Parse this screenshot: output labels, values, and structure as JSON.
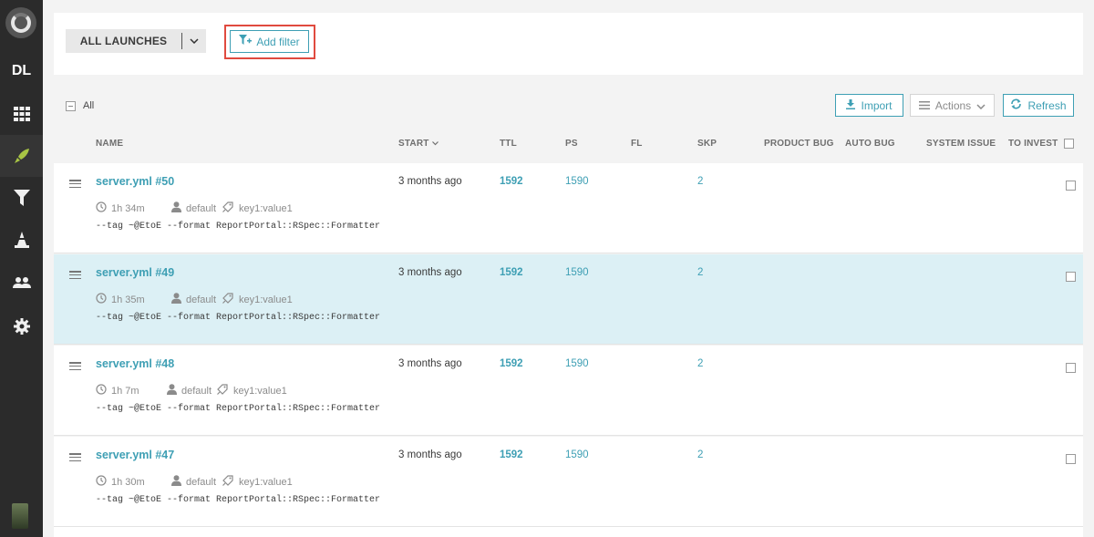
{
  "sidebar": {
    "logo": "reportportal-logo",
    "project_initials": "DL",
    "items": [
      {
        "icon": "dashboard-grid-icon"
      },
      {
        "icon": "launches-rocket-icon",
        "active": true
      },
      {
        "icon": "filter-icon"
      },
      {
        "icon": "debug-cone-icon"
      },
      {
        "icon": "members-icon"
      },
      {
        "icon": "settings-gear-icon"
      }
    ],
    "avatar": "user-avatar"
  },
  "filter_bar": {
    "launches_label": "ALL LAUNCHES",
    "add_filter_label": "Add filter"
  },
  "toolbar": {
    "all_label": "All",
    "import_label": "Import",
    "actions_label": "Actions",
    "refresh_label": "Refresh"
  },
  "columns": {
    "name": "NAME",
    "start": "START",
    "ttl": "TTL",
    "ps": "PS",
    "fl": "FL",
    "skp": "SKP",
    "product_bug": "PRODUCT BUG",
    "auto_bug": "AUTO BUG",
    "system_issue": "SYSTEM ISSUE",
    "to_invest": "TO INVEST"
  },
  "launches": [
    {
      "name": "server.yml #50",
      "duration": "1h 34m",
      "owner": "default",
      "attribute": "key1:value1",
      "description": "--tag ~@EtoE --format ReportPortal::RSpec::Formatter",
      "start": "3 months ago",
      "ttl": "1592",
      "ps": "1590",
      "skp": "2",
      "highlighted": false
    },
    {
      "name": "server.yml #49",
      "duration": "1h 35m",
      "owner": "default",
      "attribute": "key1:value1",
      "description": "--tag ~@EtoE --format ReportPortal::RSpec::Formatter",
      "start": "3 months ago",
      "ttl": "1592",
      "ps": "1590",
      "skp": "2",
      "highlighted": true
    },
    {
      "name": "server.yml #48",
      "duration": "1h 7m",
      "owner": "default",
      "attribute": "key1:value1",
      "description": "--tag ~@EtoE --format ReportPortal::RSpec::Formatter",
      "start": "3 months ago",
      "ttl": "1592",
      "ps": "1590",
      "skp": "2",
      "highlighted": false
    },
    {
      "name": "server.yml #47",
      "duration": "1h 30m",
      "owner": "default",
      "attribute": "key1:value1",
      "description": "--tag ~@EtoE --format ReportPortal::RSpec::Formatter",
      "start": "3 months ago",
      "ttl": "1592",
      "ps": "1590",
      "skp": "2",
      "highlighted": false
    }
  ],
  "colors": {
    "accent": "#3e9fb4",
    "sidebar": "#2b2b2b",
    "highlight_row": "#dcf0f5",
    "annotation_outline": "#e04a3f"
  }
}
